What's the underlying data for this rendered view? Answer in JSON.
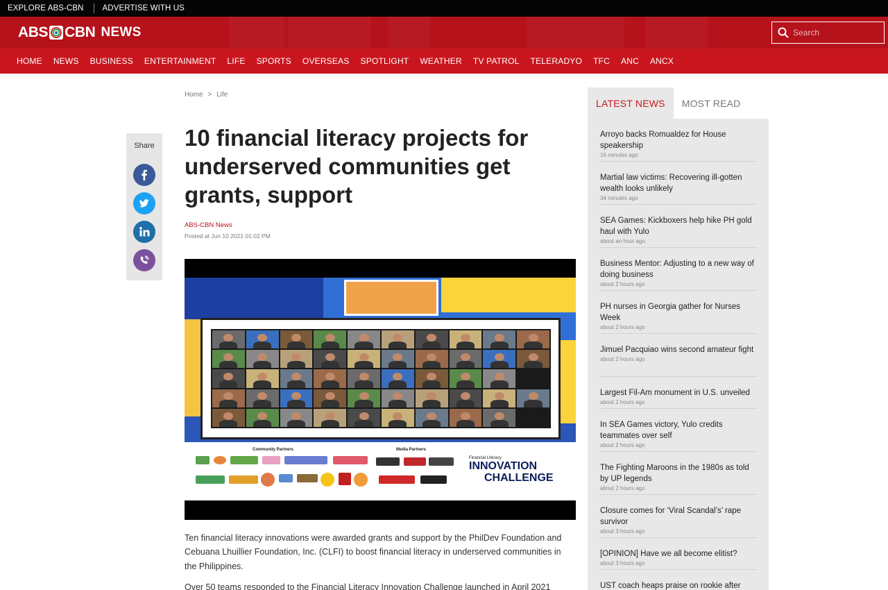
{
  "topbar": {
    "explore": "EXPLORE ABS-CBN",
    "advertise": "ADVERTISE WITH US"
  },
  "header": {
    "logo_left": "ABS",
    "logo_right": "CBN",
    "logo_news": "NEWS",
    "search_placeholder": "Search",
    "brand_color": "#b5121b"
  },
  "nav": [
    "HOME",
    "NEWS",
    "BUSINESS",
    "ENTERTAINMENT",
    "LIFE",
    "SPORTS",
    "OVERSEAS",
    "SPOTLIGHT",
    "WEATHER",
    "TV PATROL",
    "TELERADYO",
    "TFC",
    "ANC",
    "ANCX"
  ],
  "breadcrumb": {
    "home": "Home",
    "sep": ">",
    "section": "Life"
  },
  "share": {
    "label": "Share",
    "buttons": [
      {
        "icon": "facebook-icon",
        "color": "#3b5998"
      },
      {
        "icon": "twitter-icon",
        "color": "#1da1f2"
      },
      {
        "icon": "linkedin-icon",
        "color": "#1f6fa8"
      },
      {
        "icon": "viber-icon",
        "color": "#7b519d"
      }
    ]
  },
  "article": {
    "title": "10 financial literacy projects for underserved communities get grants, support",
    "author": "ABS-CBN News",
    "posted": "Posted at Jun 10 2021 01:02 PM",
    "image": {
      "community_label": "Community Partners",
      "media_label": "Media Partners",
      "challenge_small": "Financial Literacy",
      "challenge_line1": "INNOVATION",
      "challenge_line2": "CHALLENGE"
    },
    "paragraphs": [
      "Ten financial literacy innovations were awarded grants and support by the PhilDev Foundation and Cebuana Lhuillier Foundation, Inc. (CLFI) to boost financial literacy in underserved communities in the Philippines.",
      "Over 50 teams responded to the Financial Literacy Innovation Challenge launched in April 2021"
    ]
  },
  "sidebar": {
    "tab_latest": "LATEST NEWS",
    "tab_most_read": "MOST READ",
    "items": [
      {
        "headline": "Arroyo backs Romualdez for House speakership",
        "time": "16 minutes ago"
      },
      {
        "headline": "Martial law victims: Recovering ill-gotten wealth looks unlikely",
        "time": "34 minutes ago"
      },
      {
        "headline": "SEA Games: Kickboxers help hike PH gold haul with Yulo",
        "time": "about an hour ago"
      },
      {
        "headline": "Business Mentor: Adjusting to a new way of doing business",
        "time": "about 2 hours ago"
      },
      {
        "headline": "PH nurses in Georgia gather for Nurses Week",
        "time": "about 2 hours ago"
      },
      {
        "headline": "Jimuel Pacquiao wins second amateur fight",
        "time": "about 2 hours ago"
      },
      {
        "headline": "Largest Fil-Am monument in U.S. unveiled",
        "time": "about 2 hours ago"
      },
      {
        "headline": "In SEA Games victory, Yulo credits teammates over self",
        "time": "about 2 hours ago"
      },
      {
        "headline": "The Fighting Maroons in the 1980s as told by UP legends",
        "time": "about 2 hours ago"
      },
      {
        "headline": "Closure comes for ‘Viral Scandal’s’ rape survivor",
        "time": "about 3 hours ago"
      },
      {
        "headline": "[OPINION] Have we all become elitist?",
        "time": "about 3 hours ago"
      },
      {
        "headline": "UST coach heaps praise on rookie after",
        "time": ""
      }
    ]
  }
}
